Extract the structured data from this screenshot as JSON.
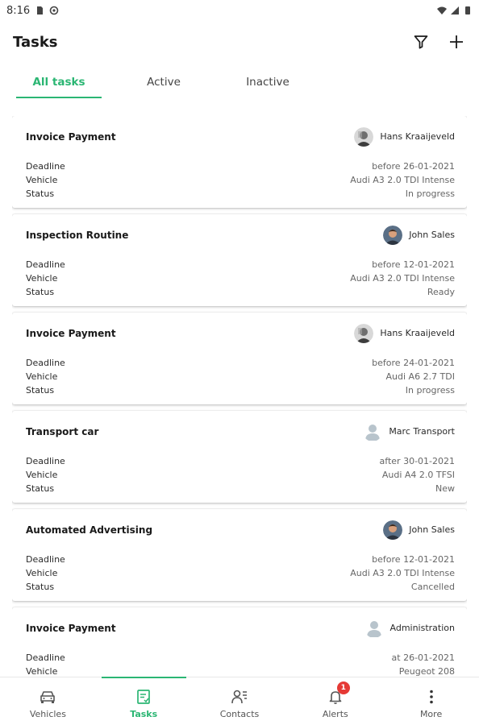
{
  "status_bar": {
    "time": "8:16"
  },
  "app_bar": {
    "title": "Tasks",
    "filter_icon": "filter-icon",
    "add_icon": "plus-icon"
  },
  "tabs": [
    {
      "label": "All tasks",
      "selected": true
    },
    {
      "label": "Active",
      "selected": false
    },
    {
      "label": "Inactive",
      "selected": false
    }
  ],
  "tasks": [
    {
      "title": "Invoice Payment",
      "assignee": "Hans Kraaijeveld",
      "avatar": "photo-gray",
      "rows": [
        {
          "label": "Deadline",
          "value": "before 26-01-2021"
        },
        {
          "label": "Vehicle",
          "value": "Audi A3 2.0 TDI Intense"
        },
        {
          "label": "Status",
          "value": "In progress"
        }
      ]
    },
    {
      "title": "Inspection Routine",
      "assignee": "John Sales",
      "avatar": "photo-color",
      "rows": [
        {
          "label": "Deadline",
          "value": "before 12-01-2021"
        },
        {
          "label": "Vehicle",
          "value": "Audi A3 2.0 TDI Intense"
        },
        {
          "label": "Status",
          "value": "Ready"
        }
      ]
    },
    {
      "title": "Invoice Payment",
      "assignee": "Hans Kraaijeveld",
      "avatar": "photo-gray",
      "rows": [
        {
          "label": "Deadline",
          "value": "before 24-01-2021"
        },
        {
          "label": "Vehicle",
          "value": "Audi A6 2.7 TDI"
        },
        {
          "label": "Status",
          "value": "In progress"
        }
      ]
    },
    {
      "title": "Transport car",
      "assignee": "Marc Transport",
      "avatar": "placeholder",
      "rows": [
        {
          "label": "Deadline",
          "value": "after 30-01-2021"
        },
        {
          "label": "Vehicle",
          "value": "Audi A4 2.0 TFSI"
        },
        {
          "label": "Status",
          "value": "New"
        }
      ]
    },
    {
      "title": "Automated Advertising",
      "assignee": "John Sales",
      "avatar": "photo-color",
      "rows": [
        {
          "label": "Deadline",
          "value": "before 12-01-2021"
        },
        {
          "label": "Vehicle",
          "value": "Audi A3 2.0 TDI Intense"
        },
        {
          "label": "Status",
          "value": "Cancelled"
        }
      ]
    },
    {
      "title": "Invoice Payment",
      "assignee": "Administration",
      "avatar": "placeholder",
      "rows": [
        {
          "label": "Deadline",
          "value": "at 26-01-2021"
        },
        {
          "label": "Vehicle",
          "value": "Peugeot 208"
        }
      ]
    }
  ],
  "bottom_nav": [
    {
      "label": "Vehicles",
      "icon": "car-icon",
      "active": false
    },
    {
      "label": "Tasks",
      "icon": "tasks-icon",
      "active": true
    },
    {
      "label": "Contacts",
      "icon": "contacts-icon",
      "active": false
    },
    {
      "label": "Alerts",
      "icon": "bell-icon",
      "active": false,
      "badge": "1"
    },
    {
      "label": "More",
      "icon": "more-vertical-icon",
      "active": false
    }
  ],
  "colors": {
    "accent": "#2bb673",
    "badge": "#e53935"
  }
}
